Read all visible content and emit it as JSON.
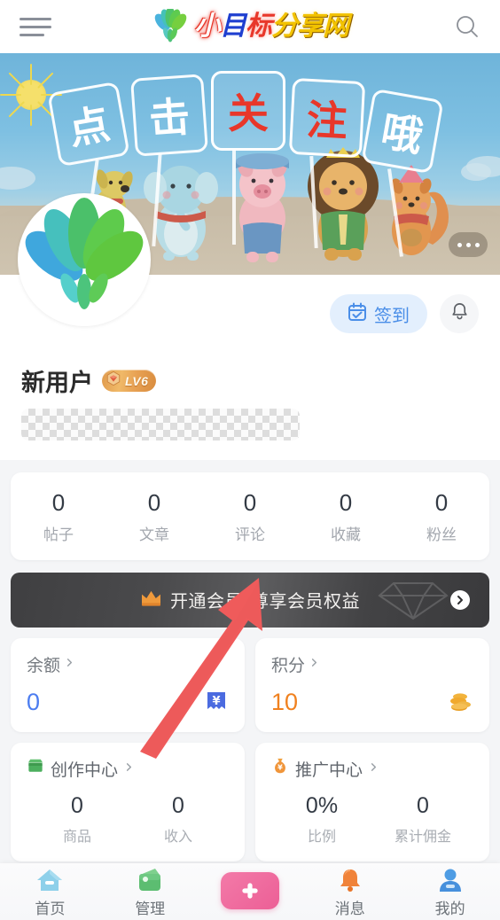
{
  "header": {
    "menu_icon": "hamburger-menu-icon",
    "logo_icon": "leaf-logo-icon",
    "brand_parts": {
      "p1": "小",
      "p2": "目",
      "p3": "标",
      "p4": "分享网"
    },
    "brand_full": "小目标分享网",
    "search_icon": "search-icon"
  },
  "banner": {
    "signs": [
      {
        "char": "点",
        "color": "white"
      },
      {
        "char": "击",
        "color": "white"
      },
      {
        "char": "关",
        "color": "red"
      },
      {
        "char": "注",
        "color": "red"
      },
      {
        "char": "哦",
        "color": "white"
      }
    ],
    "slogan": "点击关注哦",
    "more_button": "more-options-button"
  },
  "profile": {
    "avatar_icon": "leaf-avatar-logo",
    "checkin_label": "签到",
    "checkin_icon": "calendar-check-icon",
    "checkin_bg": "#e3effd",
    "checkin_fg": "#4a8ee8",
    "bell_icon": "notification-bell-icon",
    "username": "新用户",
    "level_badge": "LV6",
    "level_gem_icon": "gem-icon",
    "bio_placeholder": ""
  },
  "stats": [
    {
      "value": "0",
      "label": "帖子"
    },
    {
      "value": "0",
      "label": "文章"
    },
    {
      "value": "0",
      "label": "评论"
    },
    {
      "value": "0",
      "label": "收藏"
    },
    {
      "value": "0",
      "label": "粉丝"
    }
  ],
  "vip": {
    "crown_icon": "crown-icon",
    "title": "开通会员",
    "subtitle": "尊享会员权益",
    "chevron_icon": "chevron-right-icon",
    "diamond_icon": "diamond-watermark-icon"
  },
  "wallet": {
    "balance": {
      "title": "余额",
      "chevron": "chevron-right-icon",
      "value": "0",
      "value_color": "#4c7df0",
      "icon": "yuan-receipt-icon"
    },
    "points": {
      "title": "积分",
      "chevron": "chevron-right-icon",
      "value": "10",
      "value_color": "#f0811f",
      "icon": "coins-icon"
    }
  },
  "centers": {
    "creation": {
      "icon": "shop-icon",
      "title": "创作中心",
      "chevron": "chevron-right-icon",
      "stats": [
        {
          "value": "0",
          "label": "商品"
        },
        {
          "value": "0",
          "label": "收入"
        }
      ]
    },
    "promotion": {
      "icon": "money-bag-icon",
      "title": "推广中心",
      "chevron": "chevron-right-icon",
      "stats": [
        {
          "value": "0%",
          "label": "比例"
        },
        {
          "value": "0",
          "label": "累计佣金"
        }
      ]
    }
  },
  "annotation": {
    "arrow_color": "#ef5b5b",
    "points_to": "开通会员"
  },
  "tabbar": [
    {
      "label": "首页",
      "icon": "home-icon",
      "color": "#7ec8e8"
    },
    {
      "label": "管理",
      "icon": "wallet-icon",
      "color": "#5fbf7a"
    },
    {
      "label": "",
      "icon": "plus-icon",
      "color": "#ec5f96"
    },
    {
      "label": "消息",
      "icon": "bell-icon",
      "color": "#f07a32"
    },
    {
      "label": "我的",
      "icon": "user-icon",
      "color": "#4c94e0"
    }
  ]
}
